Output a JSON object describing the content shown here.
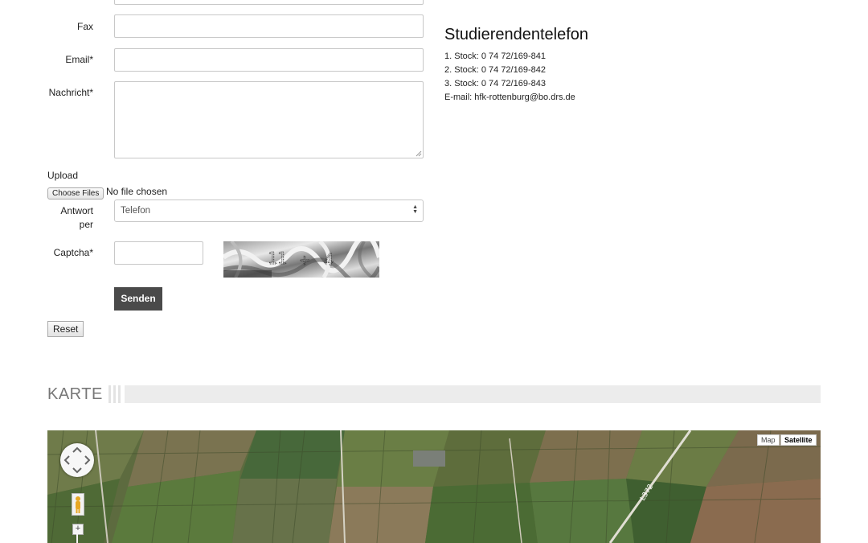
{
  "form": {
    "fax_label": "Fax",
    "email_label": "Email*",
    "message_label": "Nachricht*",
    "upload_label": "Upload",
    "choose_files_label": "Choose Files",
    "no_file_text": "No file chosen",
    "answer_label_line1": "Antwort",
    "answer_label_line2": "per",
    "answer_selected": "Telefon",
    "captcha_label": "Captcha*",
    "send_label": "Senden",
    "reset_label": "Reset"
  },
  "contact": {
    "title": "Studierendentelefon",
    "lines": [
      "1. Stock: 0 74 72/169-841",
      "2. Stock: 0 74 72/169-842",
      "3. Stock: 0 74 72/169-843",
      "E-mail: hfk-rottenburg@bo.drs.de"
    ]
  },
  "map_section": {
    "title": "KARTE",
    "map_type_map": "Map",
    "map_type_satellite": "Satellite",
    "road_label": "L372"
  }
}
